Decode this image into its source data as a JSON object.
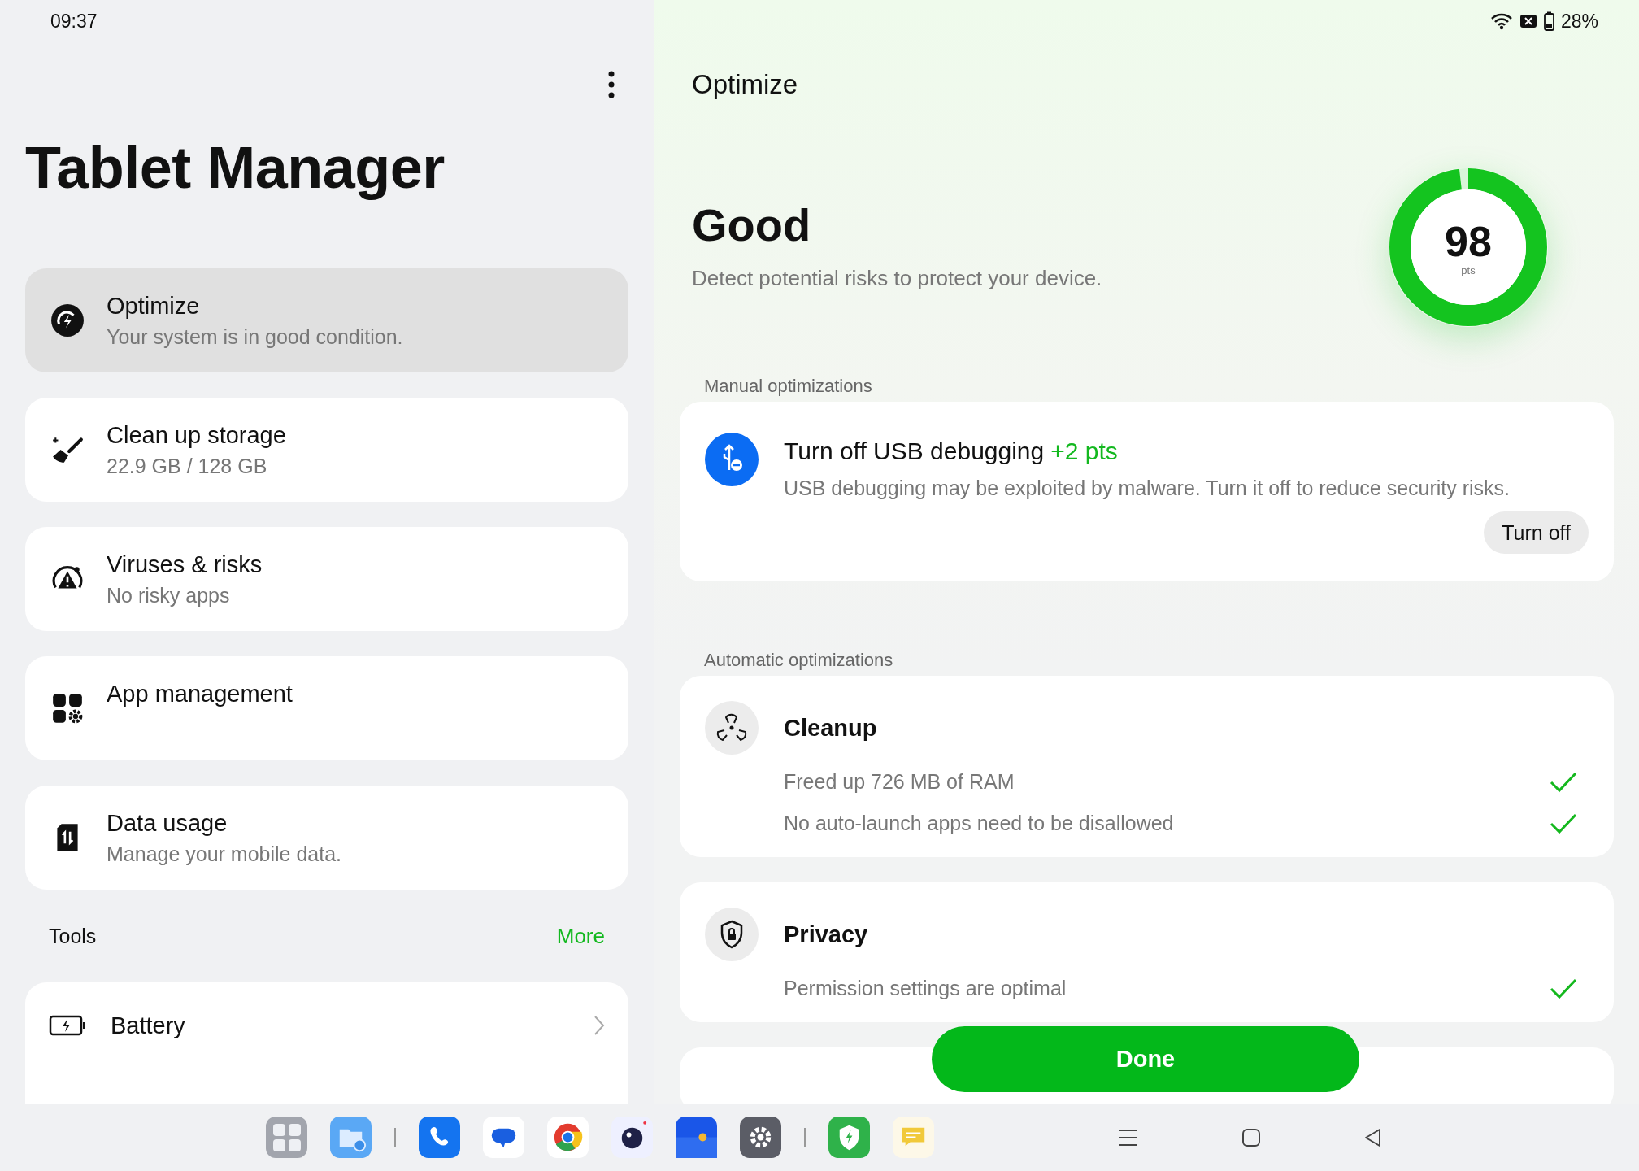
{
  "status_bar": {
    "time": "09:37",
    "battery": "28%"
  },
  "left": {
    "title": "Tablet Manager",
    "items": [
      {
        "kind": "optimize",
        "title": "Optimize",
        "subtitle": "Your system is in good condition.",
        "selected": true
      },
      {
        "kind": "storage",
        "title": "Clean up storage",
        "subtitle": "22.9 GB / 128 GB",
        "selected": false
      },
      {
        "kind": "virus",
        "title": "Viruses & risks",
        "subtitle": "No risky apps",
        "selected": false
      },
      {
        "kind": "apps",
        "title": "App management",
        "selected": false
      },
      {
        "kind": "data",
        "title": "Data usage",
        "subtitle": "Manage your mobile data.",
        "selected": false
      }
    ],
    "tools": {
      "label": "Tools",
      "more": "More",
      "items": [
        {
          "kind": "battery",
          "label": "Battery"
        }
      ]
    }
  },
  "right": {
    "title": "Optimize",
    "status": "Good",
    "description": "Detect potential risks to protect your device.",
    "score": {
      "value": "98",
      "unit": "pts",
      "level": 0.98
    },
    "manual": {
      "label": "Manual optimizations",
      "items": [
        {
          "kind": "usb",
          "title": "Turn off USB debugging",
          "points": "+2 pts",
          "description": "USB debugging may be exploited by malware. Turn it off to reduce security risks.",
          "button": "Turn off"
        }
      ]
    },
    "automatic": {
      "label": "Automatic optimizations",
      "groups": [
        {
          "kind": "cleanup",
          "title": "Cleanup",
          "checks": [
            {
              "text": "Freed up 726 MB of RAM",
              "done": true
            },
            {
              "text": "No auto-launch apps need to be disallowed",
              "done": true
            }
          ]
        },
        {
          "kind": "privacy",
          "title": "Privacy",
          "checks": [
            {
              "text": "Permission settings are optimal",
              "done": true
            }
          ]
        }
      ]
    },
    "done_button": "Done"
  }
}
